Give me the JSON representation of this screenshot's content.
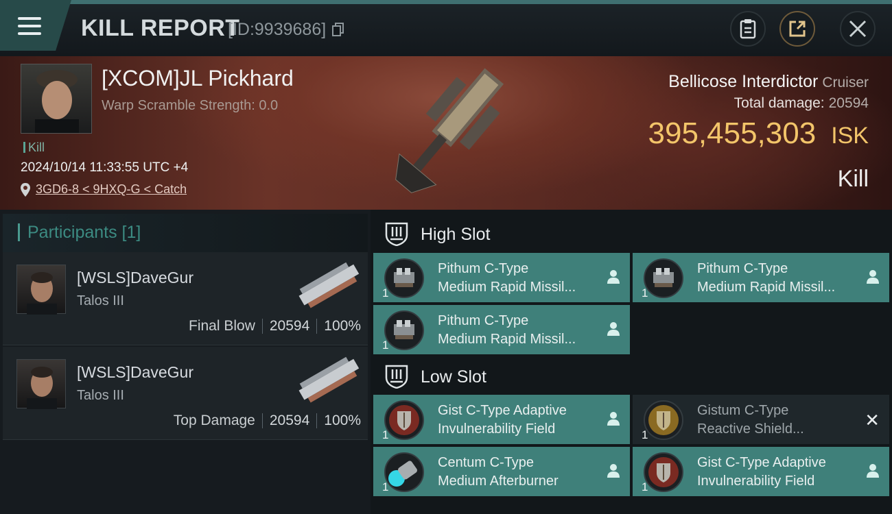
{
  "header": {
    "title": "KILL REPORT",
    "id_text": "[ID:9939686]"
  },
  "victim": {
    "name": "[XCOM]JL Pickhard",
    "scramble": "Warp Scramble Strength: 0.0",
    "tag": "Kill",
    "datetime": "2024/10/14 11:33:55 UTC +4",
    "location": "3GD6-8 < 9HXQ-G < Catch"
  },
  "ship": {
    "name": "Bellicose Interdictor",
    "class": "Cruiser",
    "total_damage_label": "Total damage:",
    "total_damage": "20594",
    "isk_value": "395,455,303",
    "isk_unit": "ISK",
    "result": "Kill"
  },
  "participants": {
    "title": "Participants [1]",
    "rows": [
      {
        "name": "[WSLS]DaveGur",
        "ship": "Talos III",
        "label": "Final Blow",
        "damage": "20594",
        "percent": "100%"
      },
      {
        "name": "[WSLS]DaveGur",
        "ship": "Talos III",
        "label": "Top Damage",
        "damage": "20594",
        "percent": "100%"
      }
    ]
  },
  "slots": {
    "high": {
      "title": "High Slot",
      "modules": [
        {
          "line1": "Pithum C-Type",
          "line2": "Medium Rapid Missil...",
          "qty": "1"
        },
        {
          "line1": "Pithum C-Type",
          "line2": "Medium Rapid Missil...",
          "qty": "1"
        },
        {
          "line1": "Pithum C-Type",
          "line2": "Medium Rapid Missil...",
          "qty": "1"
        }
      ]
    },
    "low": {
      "title": "Low Slot",
      "modules": [
        {
          "line1": "Gist C-Type Adaptive",
          "line2": "Invulnerability Field",
          "qty": "1"
        },
        {
          "line1": "Gistum C-Type",
          "line2": "Reactive Shield...",
          "qty": "1"
        },
        {
          "line1": "Centum C-Type",
          "line2": "Medium Afterburner",
          "qty": "1"
        },
        {
          "line1": "Gist C-Type Adaptive",
          "line2": "Invulnerability Field",
          "qty": "1"
        }
      ]
    }
  },
  "colors": {
    "accent": "#3f807a",
    "isk": "#f3c56a"
  }
}
